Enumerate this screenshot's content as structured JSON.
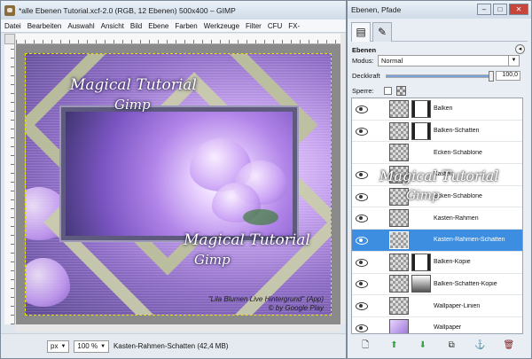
{
  "left_window": {
    "title": "*alle Ebenen Tutorial.xcf-2.0 (RGB, 12 Ebenen) 500x400 – GIMP",
    "menu": [
      "Datei",
      "Bearbeiten",
      "Auswahl",
      "Ansicht",
      "Bild",
      "Ebene",
      "Farben",
      "Werkzeuge",
      "Filter",
      "CFU",
      "FX-"
    ],
    "canvas": {
      "watermark_line1": "Magical Tutorial",
      "watermark_line2": "Gimp",
      "credit_line1": "\"Lila Blumen Live Hintergrund\" (App)",
      "credit_line2": "© by Google Play"
    },
    "status": {
      "unit": "px",
      "zoom": "100 %",
      "text": "Kasten-Rahmen-Schatten (42,4 MB)"
    }
  },
  "right_window": {
    "title": "Ebenen, Pfade",
    "section": "Ebenen",
    "mode_label": "Modus:",
    "mode_value": "Normal",
    "opacity_label": "Deckkraft",
    "opacity_value": "100,0",
    "opacity_fraction": 1.0,
    "lock_label": "Sperre:",
    "layers": [
      {
        "name": "Balken",
        "visible": true,
        "thumb": "checker",
        "mask": "white"
      },
      {
        "name": "Balken-Schatten",
        "visible": true,
        "thumb": "checker",
        "mask": "white"
      },
      {
        "name": "Ecken-Schablone",
        "visible": false,
        "thumb": "checker",
        "mask": "none"
      },
      {
        "name": "Kasten",
        "visible": true,
        "thumb": "checker",
        "mask": "none"
      },
      {
        "name": "Ecken-Schablone",
        "visible": true,
        "thumb": "checker",
        "mask": "none"
      },
      {
        "name": "Kasten-Rahmen",
        "visible": true,
        "thumb": "checker",
        "mask": "none"
      },
      {
        "name": "Kasten-Rahmen-Schatten",
        "visible": true,
        "thumb": "checker",
        "mask": "none",
        "selected": true
      },
      {
        "name": "Balken-Kopie",
        "visible": true,
        "thumb": "checker",
        "mask": "white"
      },
      {
        "name": "Balken-Schatten-Kopie",
        "visible": true,
        "thumb": "checker",
        "mask": "grad"
      },
      {
        "name": "Wallpaper-Linien",
        "visible": true,
        "thumb": "checker",
        "mask": "none"
      },
      {
        "name": "Wallpaper",
        "visible": true,
        "thumb": "img",
        "mask": "none"
      }
    ],
    "watermark_line1": "Magical Tutorial",
    "watermark_line2": "Gimp"
  }
}
